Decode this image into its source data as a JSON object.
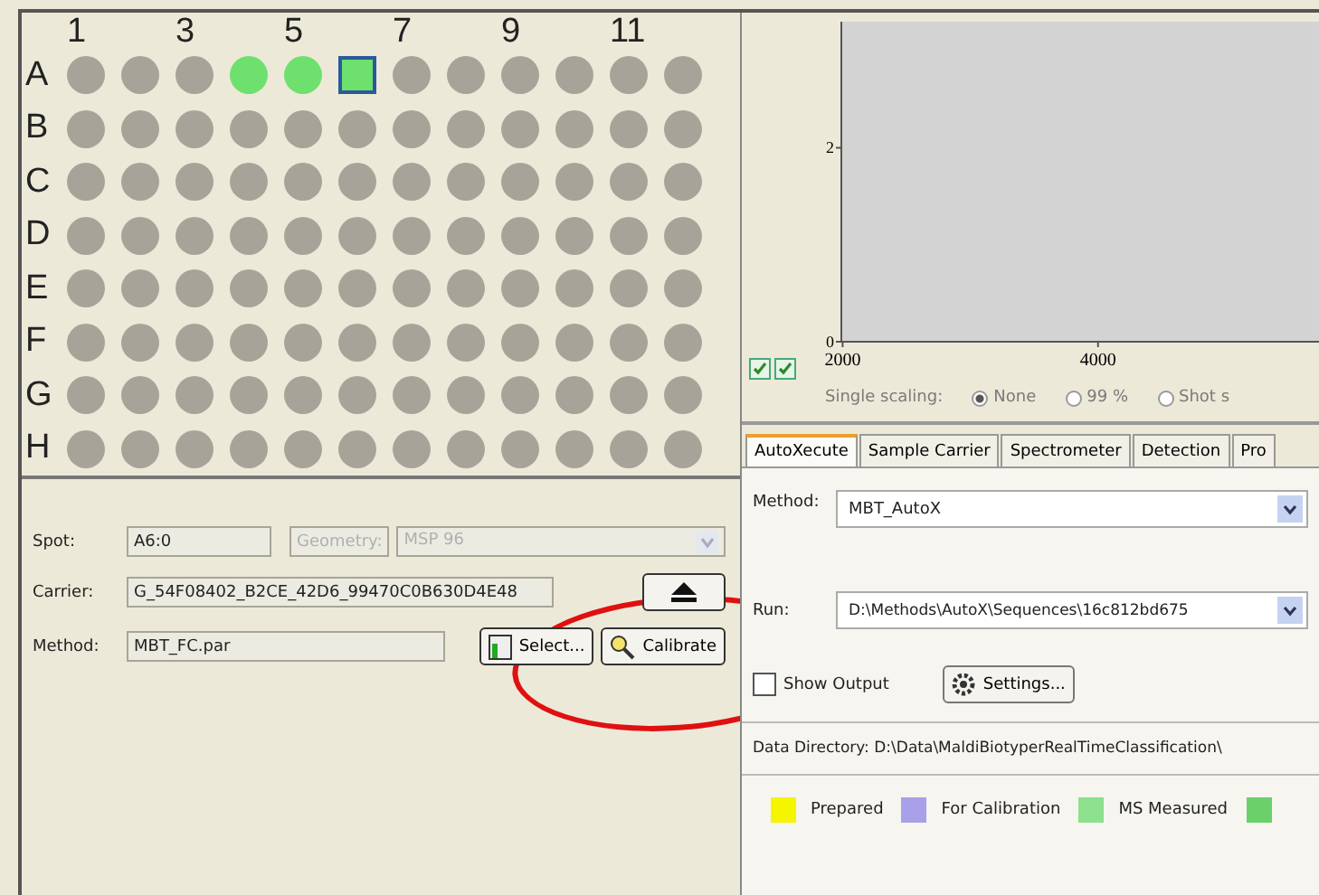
{
  "plate": {
    "column_labels": [
      "1",
      "3",
      "5",
      "7",
      "9",
      "11"
    ],
    "rows": [
      {
        "label": "A",
        "wells": [
          {
            "color": "#a8a399",
            "selected": false
          },
          {
            "color": "#a8a399",
            "selected": false
          },
          {
            "color": "#a8a399",
            "selected": false
          },
          {
            "color": "#6ee06e",
            "selected": false
          },
          {
            "color": "#6ee06e",
            "selected": false
          },
          {
            "color": "#6ee06e",
            "selected": true
          },
          {
            "color": "#a8a399",
            "selected": false
          },
          {
            "color": "#a8a399",
            "selected": false
          },
          {
            "color": "#a8a399",
            "selected": false
          },
          {
            "color": "#a8a399",
            "selected": false
          },
          {
            "color": "#a8a399",
            "selected": false
          },
          {
            "color": "#a8a399",
            "selected": false
          }
        ]
      },
      {
        "label": "B",
        "wells": [
          {
            "color": "#a8a399",
            "selected": false
          },
          {
            "color": "#a8a399",
            "selected": false
          },
          {
            "color": "#a8a399",
            "selected": false
          },
          {
            "color": "#a8a399",
            "selected": false
          },
          {
            "color": "#a8a399",
            "selected": false
          },
          {
            "color": "#a8a399",
            "selected": false
          },
          {
            "color": "#a8a399",
            "selected": false
          },
          {
            "color": "#a8a399",
            "selected": false
          },
          {
            "color": "#a8a399",
            "selected": false
          },
          {
            "color": "#a8a399",
            "selected": false
          },
          {
            "color": "#a8a399",
            "selected": false
          },
          {
            "color": "#a8a399",
            "selected": false
          }
        ]
      },
      {
        "label": "C",
        "wells": [
          {
            "color": "#a8a399",
            "selected": false
          },
          {
            "color": "#a8a399",
            "selected": false
          },
          {
            "color": "#a8a399",
            "selected": false
          },
          {
            "color": "#a8a399",
            "selected": false
          },
          {
            "color": "#a8a399",
            "selected": false
          },
          {
            "color": "#a8a399",
            "selected": false
          },
          {
            "color": "#a8a399",
            "selected": false
          },
          {
            "color": "#a8a399",
            "selected": false
          },
          {
            "color": "#a8a399",
            "selected": false
          },
          {
            "color": "#a8a399",
            "selected": false
          },
          {
            "color": "#a8a399",
            "selected": false
          },
          {
            "color": "#a8a399",
            "selected": false
          }
        ]
      },
      {
        "label": "D",
        "wells": [
          {
            "color": "#a8a399",
            "selected": false
          },
          {
            "color": "#a8a399",
            "selected": false
          },
          {
            "color": "#a8a399",
            "selected": false
          },
          {
            "color": "#a8a399",
            "selected": false
          },
          {
            "color": "#a8a399",
            "selected": false
          },
          {
            "color": "#a8a399",
            "selected": false
          },
          {
            "color": "#a8a399",
            "selected": false
          },
          {
            "color": "#a8a399",
            "selected": false
          },
          {
            "color": "#a8a399",
            "selected": false
          },
          {
            "color": "#a8a399",
            "selected": false
          },
          {
            "color": "#a8a399",
            "selected": false
          },
          {
            "color": "#a8a399",
            "selected": false
          }
        ]
      },
      {
        "label": "E",
        "wells": [
          {
            "color": "#a8a399",
            "selected": false
          },
          {
            "color": "#a8a399",
            "selected": false
          },
          {
            "color": "#a8a399",
            "selected": false
          },
          {
            "color": "#a8a399",
            "selected": false
          },
          {
            "color": "#a8a399",
            "selected": false
          },
          {
            "color": "#a8a399",
            "selected": false
          },
          {
            "color": "#a8a399",
            "selected": false
          },
          {
            "color": "#a8a399",
            "selected": false
          },
          {
            "color": "#a8a399",
            "selected": false
          },
          {
            "color": "#a8a399",
            "selected": false
          },
          {
            "color": "#a8a399",
            "selected": false
          },
          {
            "color": "#a8a399",
            "selected": false
          }
        ]
      },
      {
        "label": "F",
        "wells": [
          {
            "color": "#a8a399",
            "selected": false
          },
          {
            "color": "#a8a399",
            "selected": false
          },
          {
            "color": "#a8a399",
            "selected": false
          },
          {
            "color": "#a8a399",
            "selected": false
          },
          {
            "color": "#a8a399",
            "selected": false
          },
          {
            "color": "#a8a399",
            "selected": false
          },
          {
            "color": "#a8a399",
            "selected": false
          },
          {
            "color": "#a8a399",
            "selected": false
          },
          {
            "color": "#a8a399",
            "selected": false
          },
          {
            "color": "#a8a399",
            "selected": false
          },
          {
            "color": "#a8a399",
            "selected": false
          },
          {
            "color": "#a8a399",
            "selected": false
          }
        ]
      },
      {
        "label": "G",
        "wells": [
          {
            "color": "#a8a399",
            "selected": false
          },
          {
            "color": "#a8a399",
            "selected": false
          },
          {
            "color": "#a8a399",
            "selected": false
          },
          {
            "color": "#a8a399",
            "selected": false
          },
          {
            "color": "#a8a399",
            "selected": false
          },
          {
            "color": "#a8a399",
            "selected": false
          },
          {
            "color": "#a8a399",
            "selected": false
          },
          {
            "color": "#a8a399",
            "selected": false
          },
          {
            "color": "#a8a399",
            "selected": false
          },
          {
            "color": "#a8a399",
            "selected": false
          },
          {
            "color": "#a8a399",
            "selected": false
          },
          {
            "color": "#a8a399",
            "selected": false
          }
        ]
      },
      {
        "label": "H",
        "wells": [
          {
            "color": "#a8a399",
            "selected": false
          },
          {
            "color": "#a8a399",
            "selected": false
          },
          {
            "color": "#a8a399",
            "selected": false
          },
          {
            "color": "#a8a399",
            "selected": false
          },
          {
            "color": "#a8a399",
            "selected": false
          },
          {
            "color": "#a8a399",
            "selected": false
          },
          {
            "color": "#a8a399",
            "selected": false
          },
          {
            "color": "#a8a399",
            "selected": false
          },
          {
            "color": "#a8a399",
            "selected": false
          },
          {
            "color": "#a8a399",
            "selected": false
          },
          {
            "color": "#a8a399",
            "selected": false
          },
          {
            "color": "#a8a399",
            "selected": false
          }
        ]
      }
    ]
  },
  "spot_info": {
    "spot_label": "Spot:",
    "spot_value": "A6:0",
    "geometry_label": "Geometry:",
    "geometry_value": "MSP 96",
    "geometry_disabled": true,
    "carrier_label": "Carrier:",
    "carrier_value": "G_54F08402_B2CE_42D6_99470C0B630D4E48",
    "method_label": "Method:",
    "method_value": "MBT_FC.par",
    "select_button": "Select...",
    "calibrate_button": "Calibrate"
  },
  "spectrum": {
    "chart_data": {
      "type": "line",
      "xlim": [
        1990,
        5730
      ],
      "ylim": [
        0,
        3.3
      ],
      "xticks": [
        2000,
        4000
      ],
      "yticks": [
        0,
        2
      ]
    },
    "checkboxes": [
      {
        "checked": true
      },
      {
        "checked": true
      }
    ],
    "scaling": {
      "label": "Single scaling:",
      "disabled": true,
      "options": [
        {
          "label": "None",
          "selected": true
        },
        {
          "label": "99 %",
          "selected": false
        },
        {
          "label": "Shot s",
          "selected": false
        }
      ]
    }
  },
  "tabs": [
    {
      "label": "AutoXecute",
      "selected": true
    },
    {
      "label": "Sample Carrier",
      "selected": false
    },
    {
      "label": "Spectrometer",
      "selected": false
    },
    {
      "label": "Detection",
      "selected": false
    },
    {
      "label": "Pro",
      "selected": false
    }
  ],
  "autoxecute": {
    "method_label": "Method:",
    "method_value": "MBT_AutoX",
    "run_label": "Run:",
    "run_value": "D:\\Methods\\AutoX\\Sequences\\16c812bd675",
    "show_output": {
      "label": "Show Output",
      "checked": false
    },
    "settings_button": "Settings...",
    "data_directory": "Data Directory: D:\\Data\\MaldiBiotyperRealTimeClassification\\",
    "legend": [
      {
        "label": "Prepared",
        "color": "#f5f500"
      },
      {
        "label": "For Calibration",
        "color": "#a8a0e8"
      },
      {
        "label": "MS Measured",
        "color": "#8de08d"
      },
      {
        "color": "#6ad06a"
      }
    ]
  }
}
